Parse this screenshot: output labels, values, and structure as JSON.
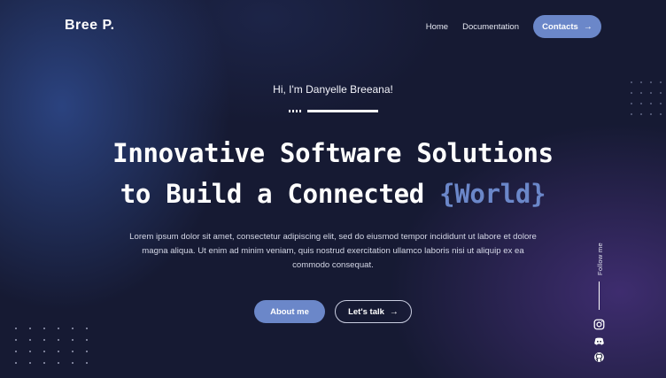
{
  "header": {
    "logo": "Bree P.",
    "nav": [
      {
        "label": "Home"
      },
      {
        "label": "Documentation"
      }
    ],
    "contacts_label": "Contacts",
    "contacts_icon": "arrow-right-icon"
  },
  "hero": {
    "greeting": "Hi, I'm Danyelle Breeana!",
    "headline_line1": "Innovative Software Solutions",
    "headline_line2_prefix": "to Build a Connected ",
    "headline_accent": "{World}",
    "lead": "Lorem ipsum dolor sit amet, consectetur adipiscing elit, sed do eiusmod tempor incididunt ut labore et dolore magna aliqua. Ut enim ad minim veniam, quis nostrud exercitation ullamco laboris nisi ut aliquip ex ea commodo consequat.",
    "primary_button": "About me",
    "secondary_button": "Let's talk",
    "secondary_icon": "arrow-right-icon"
  },
  "social": {
    "follow_label": "Follow me",
    "icons": [
      "instagram-icon",
      "discord-icon",
      "github-icon"
    ]
  },
  "colors": {
    "background": "#161a33",
    "accent": "#6b87c9",
    "text": "#ffffff"
  }
}
